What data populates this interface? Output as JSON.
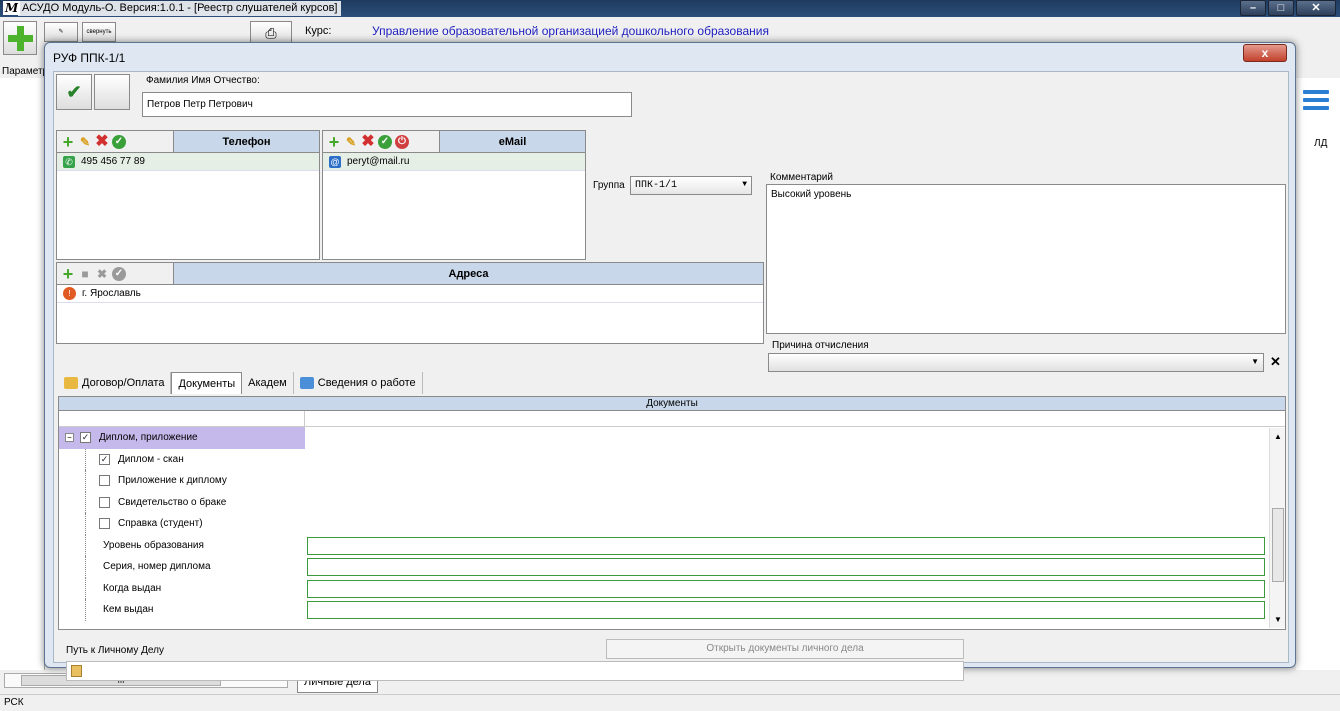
{
  "app": {
    "logo": "М",
    "title": "АСУДО Модуль-О. Версия:1.0.1 - [Реестр слушателей курсов]",
    "window_controls": [
      "–",
      "□",
      "✕"
    ],
    "toolbar": {
      "collapse_label": "свернуть",
      "course_label": "Курс:",
      "course_value": "Управление образовательной организацией дошкольного образования",
      "params_label": "Параметр"
    },
    "right_strip_label": "ЛД",
    "tab_bottom": "Личные дела",
    "scroll_thumb": "III",
    "status": "РСК"
  },
  "dialog": {
    "title": "РУФ ППК-1/1",
    "close_label": "x",
    "fio_label": "Фамилия Имя Отчество:",
    "fio_value": "Петров Петр Петрович",
    "phone_panel": {
      "title": "Телефон",
      "items": [
        "495 456 77 89"
      ]
    },
    "email_panel": {
      "title": "eMail",
      "items": [
        "peryt@mail.ru"
      ]
    },
    "address_panel": {
      "title": "Адреса",
      "items": [
        "г. Ярославль"
      ]
    },
    "group_label": "Группа",
    "group_value": "ППК-1/1",
    "comment_label": "Комментарий",
    "comment_value": "Высокий уровень",
    "reason_label": "Причина отчисления",
    "reason_value": "",
    "tabs": [
      "Договор/Оплата",
      "Документы",
      "Академ",
      "Сведения о работе"
    ],
    "active_tab": "Документы",
    "docs": {
      "header": "Документы",
      "root": {
        "label": "Диплом, приложение",
        "checked": true
      },
      "checks": [
        {
          "label": "Диплом - скан",
          "checked": true
        },
        {
          "label": "Приложение к диплому",
          "checked": false
        },
        {
          "label": "Свидетельство о браке",
          "checked": false
        },
        {
          "label": "Справка (студент)",
          "checked": false
        }
      ],
      "fields": [
        {
          "label": "Уровень образования",
          "value": ""
        },
        {
          "label": "Серия, номер диплома",
          "value": ""
        },
        {
          "label": "Когда выдан",
          "value": ""
        },
        {
          "label": "Кем выдан",
          "value": ""
        }
      ]
    },
    "path_label": "Путь к Личному Делу",
    "open_docs_button": "Открыть документы личного дела",
    "colors": {
      "accent_header": "#c8d8ea",
      "root_row": "#c5b8ea",
      "field_border": "#3c9a3c",
      "add_icon": "#46a82a",
      "delete_icon": "#d23030"
    }
  }
}
